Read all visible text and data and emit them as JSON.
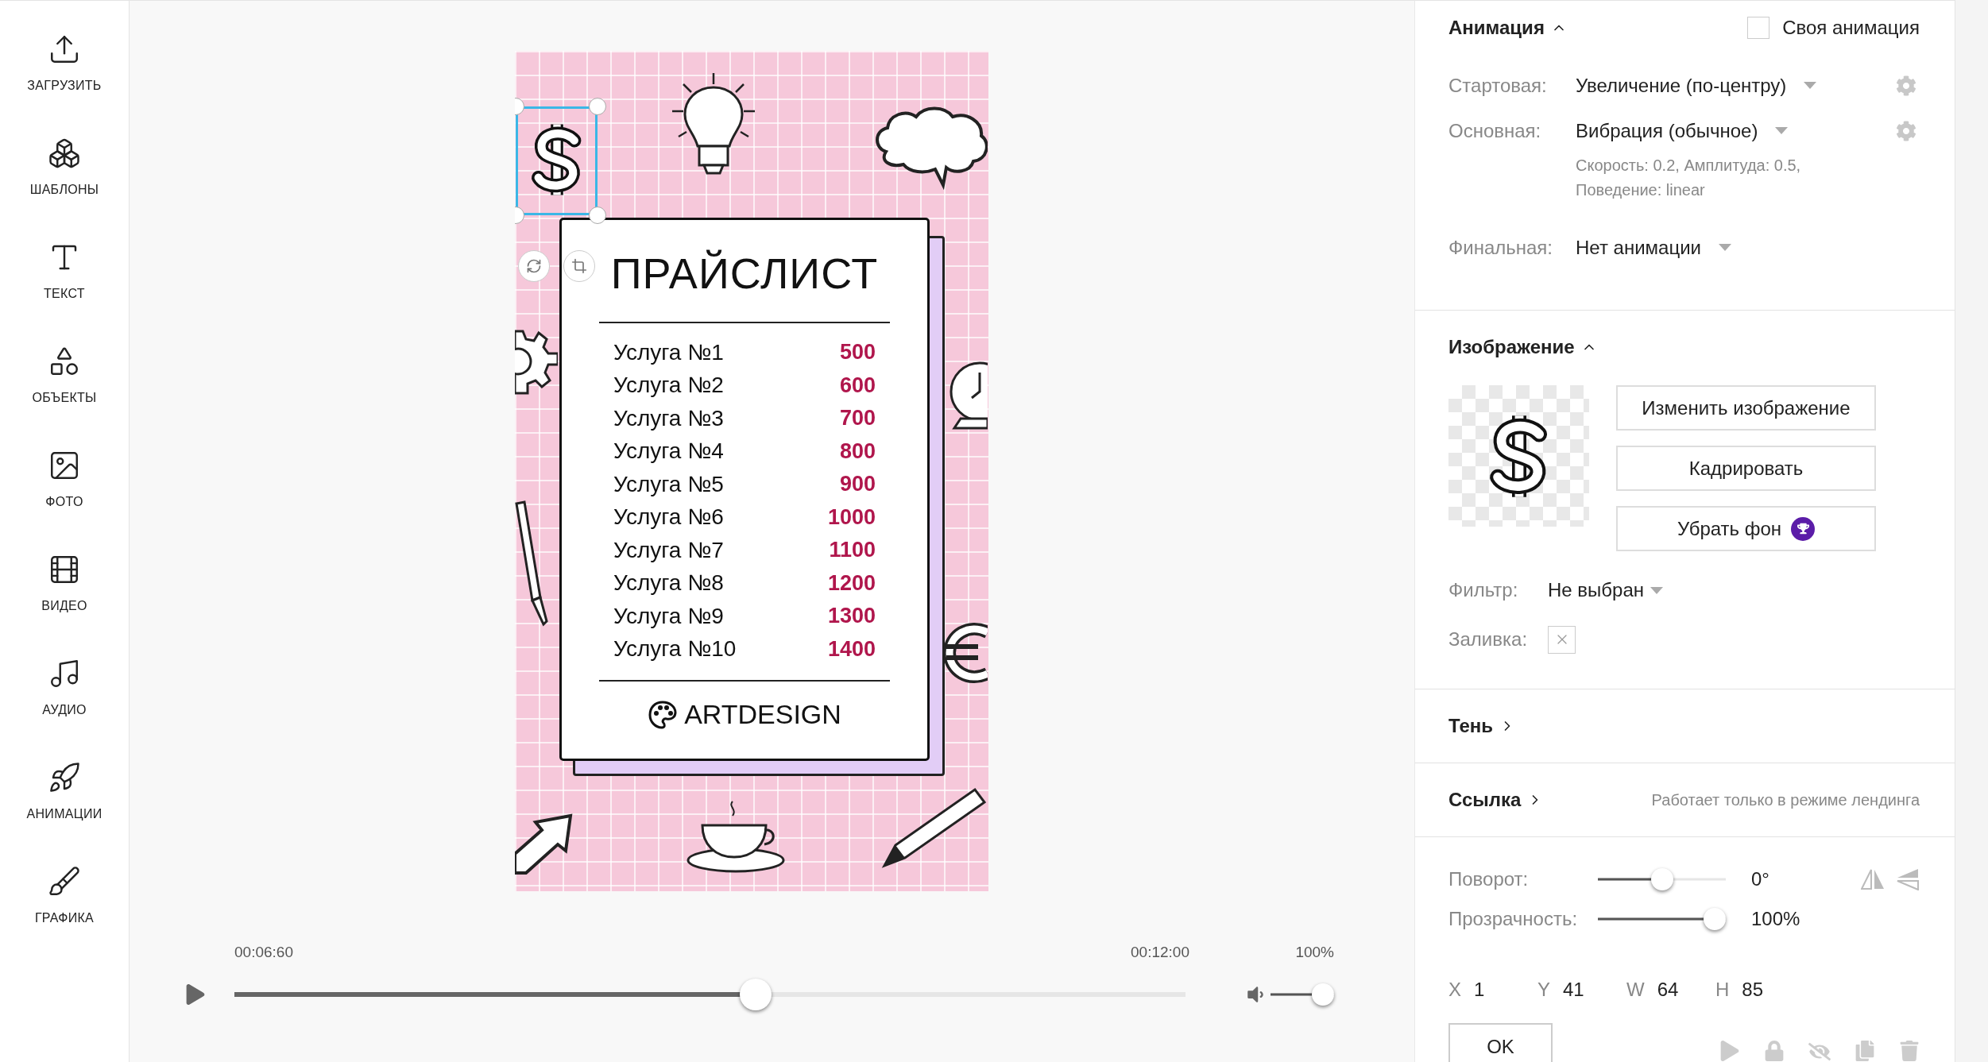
{
  "sidebar": {
    "items": [
      {
        "label": "ЗАГРУЗИТЬ",
        "kind": "upload"
      },
      {
        "label": "ШАБЛОНЫ",
        "kind": "templates"
      },
      {
        "label": "ТЕКСТ",
        "kind": "text"
      },
      {
        "label": "ОБЪЕКТЫ",
        "kind": "objects"
      },
      {
        "label": "ФОТО",
        "kind": "photo"
      },
      {
        "label": "ВИДЕО",
        "kind": "video"
      },
      {
        "label": "АУДИО",
        "kind": "audio"
      },
      {
        "label": "АНИМАЦИИ",
        "kind": "animation"
      },
      {
        "label": "ГРАФИКА",
        "kind": "graphics"
      }
    ]
  },
  "design": {
    "title": "ПРАЙСЛИСТ",
    "services": [
      {
        "name": "Услуга №1",
        "price": "500"
      },
      {
        "name": "Услуга №2",
        "price": "600"
      },
      {
        "name": "Услуга №3",
        "price": "700"
      },
      {
        "name": "Услуга №4",
        "price": "800"
      },
      {
        "name": "Услуга №5",
        "price": "900"
      },
      {
        "name": "Услуга №6",
        "price": "1000"
      },
      {
        "name": "Услуга №7",
        "price": "1100"
      },
      {
        "name": "Услуга №8",
        "price": "1200"
      },
      {
        "name": "Услуга №9",
        "price": "1300"
      },
      {
        "name": "Услуга №10",
        "price": "1400"
      }
    ],
    "brand": "ARTDESIGN"
  },
  "timeline": {
    "current_time": "00:06:60",
    "total_time": "00:12:00",
    "level": 0.55,
    "volume": {
      "reading": "100%",
      "level": 1
    }
  },
  "animation": {
    "title": "Анимация",
    "expanded": true,
    "custom": {
      "label": "Своя анимация",
      "checked": false
    },
    "rows": [
      {
        "label": "Стартовая:",
        "value": "Увеличение (по-центру)",
        "settings": true
      },
      {
        "label": "Основная:",
        "value": "Вибрация (обычное)",
        "settings": true,
        "details": "Скорость: 0.2, Амплитуда: 0.5, Поведение: linear"
      },
      {
        "label": "Финальная:",
        "value": "Нет анимации",
        "settings": false
      }
    ]
  },
  "image": {
    "title": "Изображение",
    "expanded": true,
    "buttons": [
      {
        "label": "Изменить изображение",
        "premium": false
      },
      {
        "label": "Кадрировать",
        "premium": false
      },
      {
        "label": "Убрать фон",
        "premium": true
      }
    ],
    "filter": {
      "label": "Фильтр:",
      "value": "Не выбран"
    },
    "fill": {
      "label": "Заливка:"
    }
  },
  "shadow": {
    "title": "Тень",
    "expanded": false
  },
  "link": {
    "title": "Ссылка",
    "expanded": false,
    "note": "Работает только в режиме лендинга"
  },
  "transform": {
    "rotation": {
      "label": "Поворот:",
      "level": 0.5,
      "reading": "0°"
    },
    "opacity": {
      "label": "Прозрачность:",
      "level": 1,
      "reading": "100%"
    },
    "position": [
      {
        "axis": "X",
        "value": "1"
      },
      {
        "axis": "Y",
        "value": "41"
      },
      {
        "axis": "W",
        "value": "64"
      },
      {
        "axis": "H",
        "value": "85"
      }
    ]
  },
  "ok_button": "OK"
}
